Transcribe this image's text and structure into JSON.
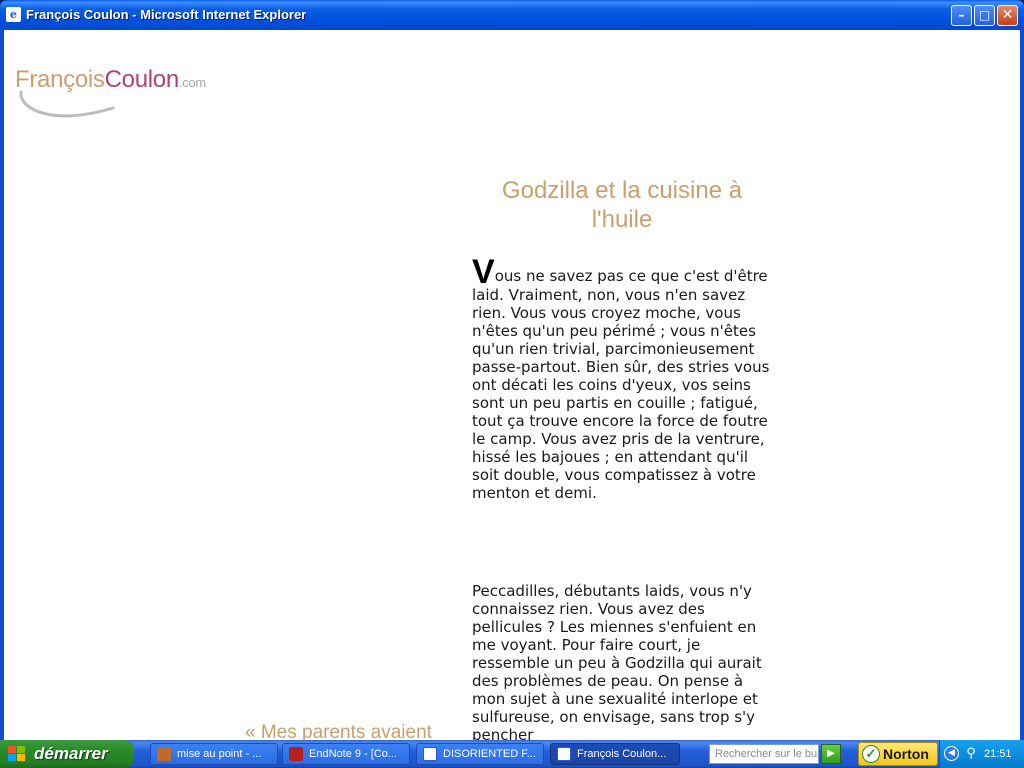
{
  "window": {
    "title": "François Coulon - Microsoft Internet Explorer",
    "minimize_glyph": "–",
    "maximize_glyph": "□",
    "close_glyph": "✕"
  },
  "logo": {
    "first": "François",
    "last": "Coulon",
    "suffix": ".com",
    "first_color": "#c9a06c",
    "last_color": "#b04177"
  },
  "article": {
    "title": "Godzilla et la cuisine à l'huile",
    "dropcap": "V",
    "paragraph1": "ous ne savez pas ce que c'est d'être laid. Vraiment, non, vous n'en savez rien. Vous vous croyez moche, vous n'êtes qu'un peu périmé ; vous n'êtes qu'un rien trivial, parcimonieusement passe-partout. Bien sûr, des stries vous ont décati les coins d'yeux, vos seins sont un peu partis en couille ; fatigué, tout ça trouve encore la force de foutre le camp. Vous avez pris de la ventrure, hissé les bajoues ; en attendant qu'il soit double, vous compatissez à votre menton et demi.",
    "paragraph2": "Peccadilles, débutants laids, vous n'y connaissez rien. Vous avez des pellicules ? Les miennes s'enfuient en me voyant. Pour faire court, je ressemble un peu à Godzilla qui aurait des problèmes de peau. On pense à mon sujet à une sexualité interlope et sulfureuse, on envisage, sans trop s'y pencher",
    "prev_link": "« Mes parents avaient"
  },
  "taskbar": {
    "start_label": "démarrer",
    "tasks": [
      {
        "label": "mise au point - ..."
      },
      {
        "label": "EndNote 9 - [Co..."
      },
      {
        "label": "DISORIENTED F..."
      },
      {
        "label": "François Coulon..."
      }
    ],
    "search_placeholder": "Rechercher sur le bur",
    "norton_label": "Norton",
    "clock": "21:51"
  },
  "colors": {
    "accent_gold": "#c9a06c",
    "accent_plum": "#b04177",
    "xp_blue": "#245edb",
    "start_green": "#2a8a2a"
  }
}
